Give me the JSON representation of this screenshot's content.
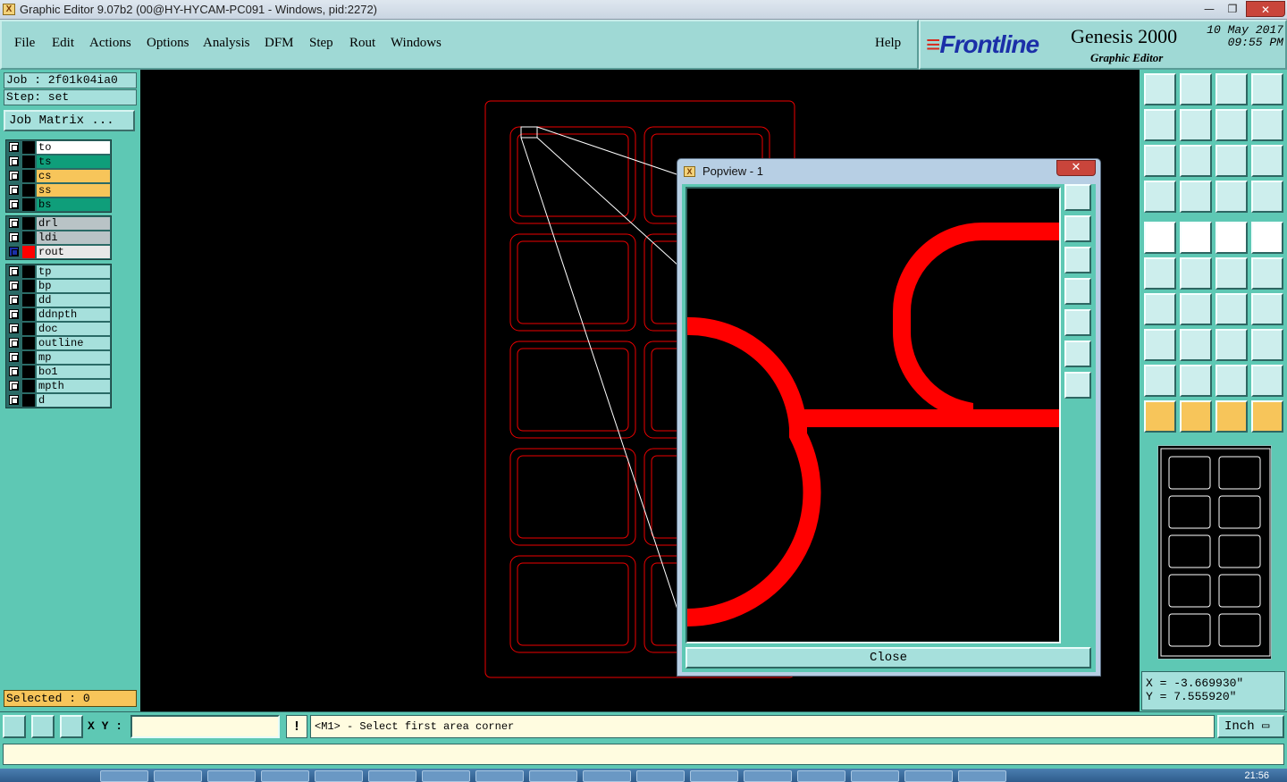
{
  "window": {
    "title": "Graphic Editor 9.07b2 (00@HY-HYCAM-PC091 - Windows, pid:2272)",
    "icon_text": "X",
    "controls": [
      "—",
      "❐",
      "✕"
    ]
  },
  "menu": {
    "items": [
      "File",
      "Edit",
      "Actions",
      "Options",
      "Analysis",
      "DFM",
      "Step",
      "Rout",
      "Windows"
    ],
    "help": "Help"
  },
  "brand": {
    "logo": "Frontline",
    "product": "Genesis 2000",
    "subtitle": "Graphic Editor",
    "date": "10 May 2017",
    "time": "09:55 PM"
  },
  "job": {
    "job_label": "Job : 2f01k04ia0",
    "step_label": "Step: set",
    "matrix_button": "Job Matrix ..."
  },
  "layers": {
    "group1": [
      {
        "name": "to",
        "color": "#ffffff"
      },
      {
        "name": "ts",
        "color": "#0f9e7a"
      },
      {
        "name": "cs",
        "color": "#f7c55a"
      },
      {
        "name": "ss",
        "color": "#f7c55a"
      },
      {
        "name": "bs",
        "color": "#0f9e7a"
      }
    ],
    "group2": [
      {
        "name": "drl",
        "color": "#b9c3c6"
      },
      {
        "name": "ldi",
        "color": "#b9c3c6"
      },
      {
        "name": "rout",
        "color": "#e8e8e8",
        "active": true
      }
    ],
    "group3": [
      {
        "name": "tp",
        "color": "#a6e0dc"
      },
      {
        "name": "bp",
        "color": "#a6e0dc"
      },
      {
        "name": "dd",
        "color": "#a6e0dc"
      },
      {
        "name": "ddnpth",
        "color": "#a6e0dc"
      },
      {
        "name": "doc",
        "color": "#a6e0dc"
      },
      {
        "name": "outline",
        "color": "#a6e0dc"
      },
      {
        "name": "mp",
        "color": "#a6e0dc"
      },
      {
        "name": "bo1",
        "color": "#a6e0dc"
      },
      {
        "name": "mpth",
        "color": "#a6e0dc"
      },
      {
        "name": "d",
        "color": "#a6e0dc"
      }
    ]
  },
  "selected": "Selected : 0",
  "popview": {
    "title": "Popview - 1",
    "close_button": "Close",
    "close_icon": "✕"
  },
  "coords": {
    "x": "X = -3.669930\"",
    "y": "Y =  7.555920\""
  },
  "bottom": {
    "xy_label": "X Y :",
    "xy_value": "",
    "warn": "!",
    "prompt": "<M1> - Select first area corner",
    "unit": "Inch"
  },
  "taskbar": {
    "clock": "21:56"
  },
  "colors": {
    "panel": "#5ec8b4",
    "field": "#a6e0dc",
    "rout": "#ff0000",
    "highlight": "#f7c55a"
  }
}
